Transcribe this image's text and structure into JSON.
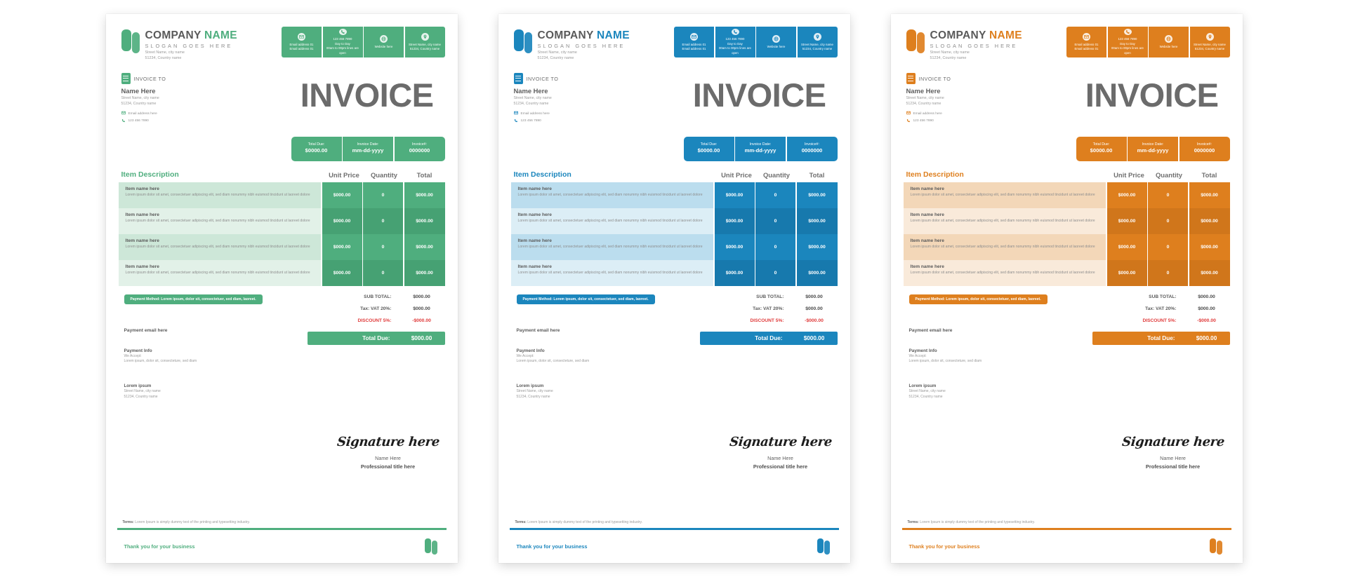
{
  "invoices": [
    {
      "accent": "#4FAE7E",
      "accent_dark": "#46A173",
      "row_tint_a": "#CDE7D8",
      "row_tint_b": "#E2F1E8",
      "header_desc_color": "#4FAE7E",
      "thanks_color": "#4FAE7E"
    },
    {
      "accent": "#1B86BD",
      "accent_dark": "#1779AD",
      "row_tint_a": "#BBDDEE",
      "row_tint_b": "#DCEEF6",
      "header_desc_color": "#1B86BD",
      "thanks_color": "#1B86BD"
    },
    {
      "accent": "#DE7F1E",
      "accent_dark": "#D0761B",
      "row_tint_a": "#F3D7B8",
      "row_tint_b": "#F9EADA",
      "header_desc_color": "#DE7F1E",
      "thanks_color": "#DE7F1E"
    }
  ],
  "content": {
    "brand": {
      "name_primary": "COMPANY",
      "name_accent": "NAME",
      "slogan": "SLOGAN GOES HERE",
      "address_line1": "Street Name, city name",
      "address_line2": "51234, Country name"
    },
    "contacts": [
      {
        "icon": "email-icon",
        "lines": [
          "Email address 01",
          "Email address 01"
        ]
      },
      {
        "icon": "phone-icon",
        "lines": [
          "123 456 7890",
          "Day to Day",
          "00am to 00pm lines are open"
        ]
      },
      {
        "icon": "globe-icon",
        "lines": [
          "Website here"
        ]
      },
      {
        "icon": "location-icon",
        "lines": [
          "Street Name, city name",
          "51234, Country name"
        ]
      }
    ],
    "invoice_to": {
      "label": "INVOICE TO",
      "name": "Name Here",
      "address_line1": "Street Name, city name",
      "address_line2": "51234, Country name",
      "email": "Email address here",
      "phone": "123 456 7890"
    },
    "title": "INVOICE",
    "summary": [
      {
        "key": "Total Due:",
        "value": "$0000.00"
      },
      {
        "key": "Invoice Date:",
        "value": "mm-dd-yyyy"
      },
      {
        "key": "Invoice#:",
        "value": "0000000"
      }
    ],
    "table": {
      "headers": {
        "description": "Item Description",
        "unit_price": "Unit Price",
        "quantity": "Quantity",
        "total": "Total"
      },
      "rows": [
        {
          "name": "Item name here",
          "desc": "Lorem ipsum dolor sit amet, consectetuer adipiscing elit, sed diam nonummy nibh euismod tincidunt ut laoreet dolore",
          "unit_price": "$000.00",
          "quantity": "0",
          "total": "$000.00"
        },
        {
          "name": "Item name here",
          "desc": "Lorem ipsum dolor sit amet, consectetuer adipiscing elit, sed diam nonummy nibh euismod tincidunt ut laoreet dolore",
          "unit_price": "$000.00",
          "quantity": "0",
          "total": "$000.00"
        },
        {
          "name": "Item name here",
          "desc": "Lorem ipsum dolor sit amet, consectetuer adipiscing elit, sed diam nonummy nibh euismod tincidunt ut laoreet dolore",
          "unit_price": "$000.00",
          "quantity": "0",
          "total": "$000.00"
        },
        {
          "name": "Item name here",
          "desc": "Lorem ipsum dolor sit amet, consectetuer adipiscing elit, sed diam nonummy nibh euismod tincidunt ut laoreet dolore",
          "unit_price": "$000.00",
          "quantity": "0",
          "total": "$000.00"
        }
      ]
    },
    "payment_method_badge": "Payment Method: Lorem ipsum, dolor sit, consectetuer, sed diam, laoreet.",
    "payment_email": "Payment email here",
    "payment_info": {
      "heading": "Payment Info",
      "line1": "We Accept:",
      "line2": "Lorem ipsum, dolor sit, consecteture, sed diam"
    },
    "lorem_block": {
      "heading": "Lorem ipsum",
      "line1": "Street Name, city name",
      "line2": "51234, Country name"
    },
    "totals": [
      {
        "label": "SUB TOTAL:",
        "value": "$000.00",
        "discount": false
      },
      {
        "label": "Tax: VAT 20%:",
        "value": "$000.00",
        "discount": false
      },
      {
        "label": "DISCOUNT 5%:",
        "value": "-$000.00",
        "discount": true
      }
    ],
    "total_due": {
      "label": "Total Due:",
      "value": "$000.00"
    },
    "signature": {
      "script": "Signature here",
      "name": "Name Here",
      "title": "Professional title here"
    },
    "terms": {
      "label": "Terms:",
      "text": "Lorem Ipsum is simply dummy text of the printing and typesetting industry."
    },
    "thanks": "Thank you for your business"
  }
}
